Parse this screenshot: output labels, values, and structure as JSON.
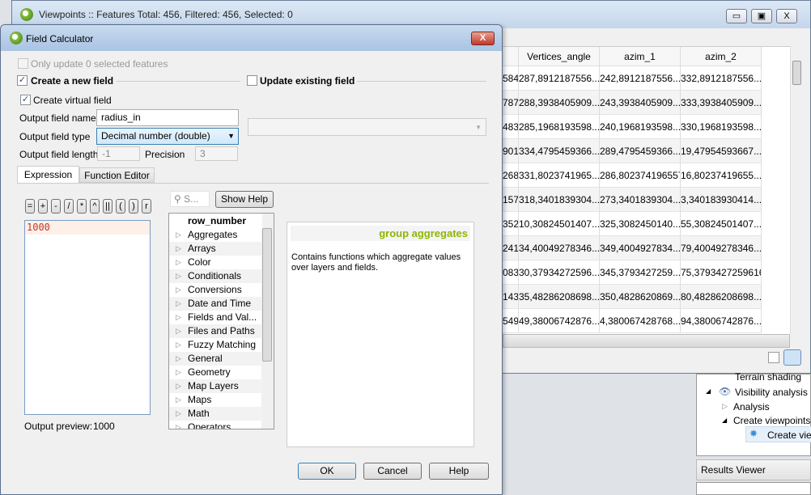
{
  "attr_window": {
    "title": "Viewpoints :: Features Total: 456, Filtered: 456, Selected: 0",
    "buttons": {
      "minimize": "▭",
      "maximize": "▣",
      "close": "X"
    },
    "columns": [
      "",
      "Vertices_angle",
      "azim_1",
      "azim_2"
    ],
    "rows": [
      [
        "584",
        "287,8912187556...",
        "242,8912187556...",
        "332,8912187556..."
      ],
      [
        "787",
        "288,3938405909...",
        "243,3938405909...",
        "333,3938405909..."
      ],
      [
        "483",
        "285,1968193598...",
        "240,1968193598...",
        "330,1968193598..."
      ],
      [
        "901",
        "334,4795459366...",
        "289,4795459366...",
        "19,47954593667..."
      ],
      [
        "268",
        "331,8023741965...",
        "286,802374196557",
        "16,80237419655..."
      ],
      [
        "157",
        "318,3401839304...",
        "273,3401839304...",
        "3,340183930414..."
      ],
      [
        "352",
        "10,30824501407...",
        "325,3082450140...",
        "55,30824501407..."
      ],
      [
        "241",
        "34,40049278346...",
        "349,4004927834...",
        "79,40049278346..."
      ],
      [
        "083",
        "30,37934272596...",
        "345,3793427259...",
        "75,3793427259616"
      ],
      [
        "143",
        "35,48286208698...",
        "350,4828620869...",
        "80,48286208698..."
      ],
      [
        "549",
        "49,38006742876...",
        "4,380067428768...",
        "94,38006742876..."
      ]
    ]
  },
  "toolbox": {
    "items": [
      {
        "label": "Terrain shading",
        "expanded": false
      },
      {
        "label": "Visibility analysis",
        "expanded": true
      },
      {
        "label": "Analysis",
        "expanded": false
      },
      {
        "label": "Create viewpoints",
        "expanded": true
      },
      {
        "label": "Create viewpoints",
        "selected": true
      }
    ],
    "results_viewer": "Results Viewer"
  },
  "dialog": {
    "title": "Field Calculator",
    "close": "X",
    "only_update": "Only update 0 selected features",
    "create_new_field": {
      "label": "Create a new field",
      "checked": true
    },
    "update_existing": {
      "label": "Update existing field",
      "checked": false
    },
    "create_virtual": {
      "label": "Create virtual field",
      "checked": true
    },
    "output_field_name": {
      "label": "Output field name",
      "value": "radius_in"
    },
    "output_field_type": {
      "label": "Output field type",
      "value": "Decimal number (double)"
    },
    "output_field_length": {
      "label": "Output field length",
      "value": "-1"
    },
    "precision": {
      "label": "Precision",
      "value": "3"
    },
    "tabs": [
      "Expression",
      "Function Editor"
    ],
    "operators": [
      "=",
      "+",
      "-",
      "/",
      "*",
      "^",
      "||",
      "(",
      ")",
      "r"
    ],
    "expression": "1000",
    "output_preview_label": "Output preview:",
    "output_preview_value": "1000",
    "search_placeholder": "S...",
    "show_help": "Show Help",
    "functions": [
      "row_number",
      "Aggregates",
      "Arrays",
      "Color",
      "Conditionals",
      "Conversions",
      "Date and Time",
      "Fields and Val...",
      "Files and Paths",
      "Fuzzy Matching",
      "General",
      "Geometry",
      "Map Layers",
      "Maps",
      "Math",
      "Operators"
    ],
    "help_title": "group aggregates",
    "help_text": "Contains functions which aggregate values over layers and fields.",
    "ok": "OK",
    "cancel": "Cancel",
    "help": "Help"
  },
  "colors": {
    "accent": "#5e9e2a",
    "help_title": "#8db600",
    "expression": "#c0392b"
  }
}
